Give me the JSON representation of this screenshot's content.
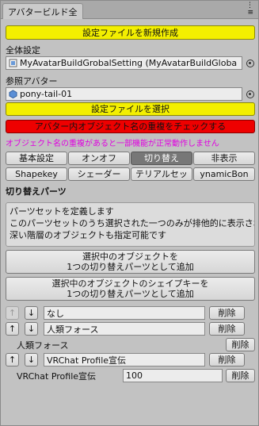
{
  "window": {
    "tab_title": "アバタービルド全",
    "controls": {
      "options_glyph": "⋮",
      "menu_glyph": "≡"
    }
  },
  "top": {
    "create_settings_button": "設定ファイルを新規作成",
    "global_settings_label": "全体設定",
    "global_settings_value": "MyAvatarBuildGrobalSetting (MyAvatarBuildGloba",
    "ref_avatar_label": "参照アバター",
    "ref_avatar_value": "pony-tail-01",
    "select_settings_button": "設定ファイルを選択",
    "check_duplicate_button": "アバター内オブジェクト名の重複をチェックする",
    "warning_text": "オブジェクト名の重複があると一部機能が正常動作しません"
  },
  "tabs_row1": [
    {
      "label": "基本設定",
      "selected": false
    },
    {
      "label": "オンオフ",
      "selected": false
    },
    {
      "label": "切り替え",
      "selected": true
    },
    {
      "label": "非表示",
      "selected": false
    }
  ],
  "tabs_row2": [
    {
      "label": "Shapekey",
      "selected": false
    },
    {
      "label": "シェーダー",
      "selected": false
    },
    {
      "label": "テリアルセッ",
      "selected": false
    },
    {
      "label": "ynamicBon",
      "selected": false
    }
  ],
  "section": {
    "title": "切り替えパーツ",
    "help_lines": [
      "パーツセットを定義します",
      "このパーツセットのうち選択された一つのみが排他的に表示されます",
      "深い階層のオブジェクトも指定可能です"
    ],
    "add_selected_objects_button": [
      "選択中のオブジェクトを",
      "1つの切り替えパーツとして追加"
    ],
    "add_selected_shapekeys_button": [
      "選択中のオブジェクトのシェイプキーを",
      "1つの切り替えパーツとして追加"
    ]
  },
  "parts": {
    "up_glyph": "↑",
    "down_glyph": "↓",
    "delete_label": "削除",
    "rows": [
      {
        "name": "なし",
        "up_enabled": false,
        "down_enabled": true
      },
      {
        "name": "人類フォース",
        "up_enabled": true,
        "down_enabled": true,
        "sub_label": "人類フォース"
      },
      {
        "name": "VRChat Profile宣伝",
        "up_enabled": true,
        "down_enabled": true,
        "sub_label": "VRChat Profile宣伝",
        "sub_value": "100"
      }
    ]
  },
  "colors": {
    "yellow": "#f3ef00",
    "red": "#ee0000",
    "warning": "#e000e0",
    "selected_tab": "#777777"
  }
}
